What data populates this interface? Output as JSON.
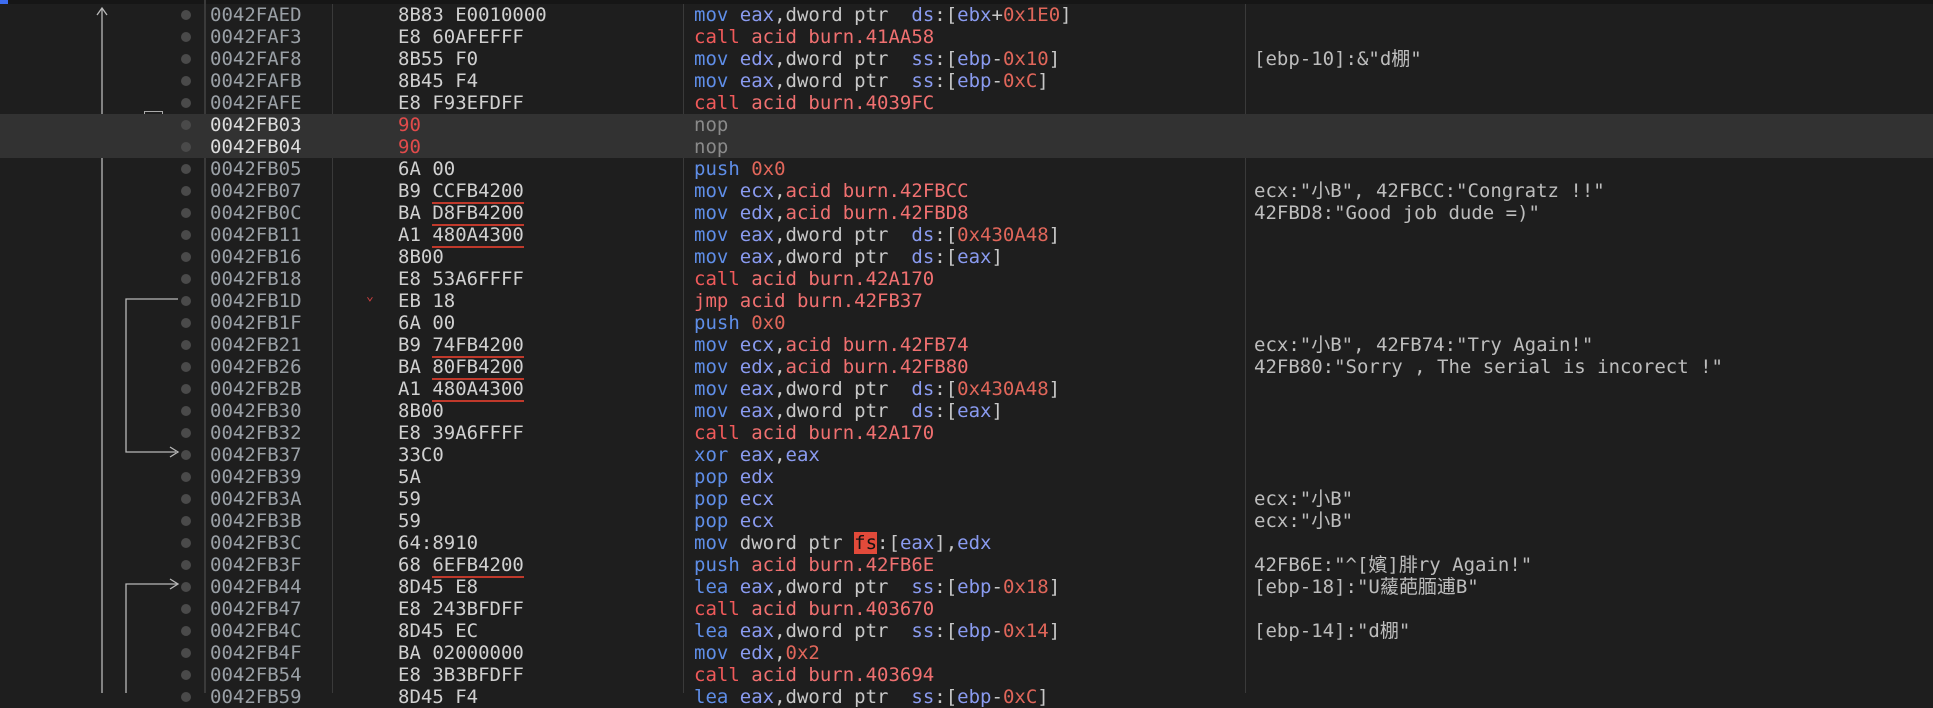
{
  "rows": [
    {
      "addr": "0042FAED",
      "bytes": [
        {
          "t": "8B83 E0010000"
        }
      ],
      "dis": [
        {
          "t": "mov ",
          "c": "m"
        },
        {
          "t": "eax",
          "c": "r"
        },
        {
          "t": ",dword ptr  ",
          "c": "p"
        },
        {
          "t": "ds",
          "c": "r"
        },
        {
          "t": ":[",
          "c": "p"
        },
        {
          "t": "ebx",
          "c": "r"
        },
        {
          "t": "+",
          "c": "p"
        },
        {
          "t": "0x1E0",
          "c": "n"
        },
        {
          "t": "]",
          "c": "p"
        }
      ],
      "comment": ""
    },
    {
      "addr": "0042FAF3",
      "bytes": [
        {
          "t": "E8 60AFEFFF"
        }
      ],
      "dis": [
        {
          "t": "call ",
          "c": "mc"
        },
        {
          "t": "acid burn.41AA58",
          "c": "sym"
        }
      ],
      "comment": ""
    },
    {
      "addr": "0042FAF8",
      "bytes": [
        {
          "t": "8B55 F0"
        }
      ],
      "dis": [
        {
          "t": "mov ",
          "c": "m"
        },
        {
          "t": "edx",
          "c": "r"
        },
        {
          "t": ",dword ptr  ",
          "c": "p"
        },
        {
          "t": "ss",
          "c": "r"
        },
        {
          "t": ":[",
          "c": "p"
        },
        {
          "t": "ebp",
          "c": "r"
        },
        {
          "t": "-",
          "c": "p"
        },
        {
          "t": "0x10",
          "c": "n"
        },
        {
          "t": "]",
          "c": "p"
        }
      ],
      "comment": "[ebp-10]:&\"d棚\""
    },
    {
      "addr": "0042FAFB",
      "bytes": [
        {
          "t": "8B45 F4"
        }
      ],
      "dis": [
        {
          "t": "mov ",
          "c": "m"
        },
        {
          "t": "eax",
          "c": "r"
        },
        {
          "t": ",dword ptr  ",
          "c": "p"
        },
        {
          "t": "ss",
          "c": "r"
        },
        {
          "t": ":[",
          "c": "p"
        },
        {
          "t": "ebp",
          "c": "r"
        },
        {
          "t": "-",
          "c": "p"
        },
        {
          "t": "0xC",
          "c": "n"
        },
        {
          "t": "]",
          "c": "p"
        }
      ],
      "comment": ""
    },
    {
      "addr": "0042FAFE",
      "bytes": [
        {
          "t": "E8 F93EFDFF"
        }
      ],
      "dis": [
        {
          "t": "call ",
          "c": "mc"
        },
        {
          "t": "acid burn.4039FC",
          "c": "sym"
        }
      ],
      "comment": ""
    },
    {
      "addr": "0042FB03",
      "bytes": [
        {
          "t": "90"
        }
      ],
      "nop": true,
      "sel": true,
      "dis": [
        {
          "t": "nop",
          "c": "mn"
        }
      ],
      "comment": ""
    },
    {
      "addr": "0042FB04",
      "bytes": [
        {
          "t": "90"
        }
      ],
      "nop": true,
      "sel": true,
      "dis": [
        {
          "t": "nop",
          "c": "mn"
        }
      ],
      "comment": ""
    },
    {
      "addr": "0042FB05",
      "bytes": [
        {
          "t": "6A 00"
        }
      ],
      "dis": [
        {
          "t": "push ",
          "c": "m"
        },
        {
          "t": "0x0",
          "c": "n"
        }
      ],
      "comment": ""
    },
    {
      "addr": "0042FB07",
      "bytes": [
        {
          "t": "B9 "
        },
        {
          "t": "CCFB4200",
          "u": true
        }
      ],
      "dis": [
        {
          "t": "mov ",
          "c": "m"
        },
        {
          "t": "ecx",
          "c": "r"
        },
        {
          "t": ",",
          "c": "p"
        },
        {
          "t": "acid burn.42FBCC",
          "c": "sym"
        }
      ],
      "comment": "ecx:\"小B\", 42FBCC:\"Congratz !!\""
    },
    {
      "addr": "0042FB0C",
      "bytes": [
        {
          "t": "BA "
        },
        {
          "t": "D8FB4200",
          "u": true
        }
      ],
      "dis": [
        {
          "t": "mov ",
          "c": "m"
        },
        {
          "t": "edx",
          "c": "r"
        },
        {
          "t": ",",
          "c": "p"
        },
        {
          "t": "acid burn.42FBD8",
          "c": "sym"
        }
      ],
      "comment": "42FBD8:\"Good job dude =)\""
    },
    {
      "addr": "0042FB11",
      "bytes": [
        {
          "t": "A1 "
        },
        {
          "t": "480A4300",
          "u": true
        }
      ],
      "dis": [
        {
          "t": "mov ",
          "c": "m"
        },
        {
          "t": "eax",
          "c": "r"
        },
        {
          "t": ",dword ptr  ",
          "c": "p"
        },
        {
          "t": "ds",
          "c": "r"
        },
        {
          "t": ":[",
          "c": "p"
        },
        {
          "t": "0x430A48",
          "c": "n"
        },
        {
          "t": "]",
          "c": "p"
        }
      ],
      "comment": ""
    },
    {
      "addr": "0042FB16",
      "bytes": [
        {
          "t": "8B00"
        }
      ],
      "dis": [
        {
          "t": "mov ",
          "c": "m"
        },
        {
          "t": "eax",
          "c": "r"
        },
        {
          "t": ",dword ptr  ",
          "c": "p"
        },
        {
          "t": "ds",
          "c": "r"
        },
        {
          "t": ":[",
          "c": "p"
        },
        {
          "t": "eax",
          "c": "r"
        },
        {
          "t": "]",
          "c": "p"
        }
      ],
      "comment": ""
    },
    {
      "addr": "0042FB18",
      "bytes": [
        {
          "t": "E8 53A6FFFF"
        }
      ],
      "dis": [
        {
          "t": "call ",
          "c": "mc"
        },
        {
          "t": "acid burn.42A170",
          "c": "sym"
        }
      ],
      "comment": ""
    },
    {
      "addr": "0042FB1D",
      "bytes": [
        {
          "t": "EB 18"
        }
      ],
      "jmpmark": true,
      "dis": [
        {
          "t": "jmp ",
          "c": "mj"
        },
        {
          "t": "acid burn.42FB37",
          "c": "sym"
        }
      ],
      "comment": ""
    },
    {
      "addr": "0042FB1F",
      "bytes": [
        {
          "t": "6A 00"
        }
      ],
      "dis": [
        {
          "t": "push ",
          "c": "m"
        },
        {
          "t": "0x0",
          "c": "n"
        }
      ],
      "comment": ""
    },
    {
      "addr": "0042FB21",
      "bytes": [
        {
          "t": "B9 "
        },
        {
          "t": "74FB4200",
          "u": true
        }
      ],
      "dis": [
        {
          "t": "mov ",
          "c": "m"
        },
        {
          "t": "ecx",
          "c": "r"
        },
        {
          "t": ",",
          "c": "p"
        },
        {
          "t": "acid burn.42FB74",
          "c": "sym"
        }
      ],
      "comment": "ecx:\"小B\", 42FB74:\"Try Again!\""
    },
    {
      "addr": "0042FB26",
      "bytes": [
        {
          "t": "BA "
        },
        {
          "t": "80FB4200",
          "u": true
        }
      ],
      "dis": [
        {
          "t": "mov ",
          "c": "m"
        },
        {
          "t": "edx",
          "c": "r"
        },
        {
          "t": ",",
          "c": "p"
        },
        {
          "t": "acid burn.42FB80",
          "c": "sym"
        }
      ],
      "comment": "42FB80:\"Sorry , The serial is incorect !\""
    },
    {
      "addr": "0042FB2B",
      "bytes": [
        {
          "t": "A1 "
        },
        {
          "t": "480A4300",
          "u": true
        }
      ],
      "dis": [
        {
          "t": "mov ",
          "c": "m"
        },
        {
          "t": "eax",
          "c": "r"
        },
        {
          "t": ",dword ptr  ",
          "c": "p"
        },
        {
          "t": "ds",
          "c": "r"
        },
        {
          "t": ":[",
          "c": "p"
        },
        {
          "t": "0x430A48",
          "c": "n"
        },
        {
          "t": "]",
          "c": "p"
        }
      ],
      "comment": ""
    },
    {
      "addr": "0042FB30",
      "bytes": [
        {
          "t": "8B00"
        }
      ],
      "dis": [
        {
          "t": "mov ",
          "c": "m"
        },
        {
          "t": "eax",
          "c": "r"
        },
        {
          "t": ",dword ptr  ",
          "c": "p"
        },
        {
          "t": "ds",
          "c": "r"
        },
        {
          "t": ":[",
          "c": "p"
        },
        {
          "t": "eax",
          "c": "r"
        },
        {
          "t": "]",
          "c": "p"
        }
      ],
      "comment": ""
    },
    {
      "addr": "0042FB32",
      "bytes": [
        {
          "t": "E8 39A6FFFF"
        }
      ],
      "dis": [
        {
          "t": "call ",
          "c": "mc"
        },
        {
          "t": "acid burn.42A170",
          "c": "sym"
        }
      ],
      "comment": ""
    },
    {
      "addr": "0042FB37",
      "bytes": [
        {
          "t": "33C0"
        }
      ],
      "dis": [
        {
          "t": "xor ",
          "c": "m"
        },
        {
          "t": "eax",
          "c": "r"
        },
        {
          "t": ",",
          "c": "p"
        },
        {
          "t": "eax",
          "c": "r"
        }
      ],
      "comment": ""
    },
    {
      "addr": "0042FB39",
      "bytes": [
        {
          "t": "5A"
        }
      ],
      "dis": [
        {
          "t": "pop ",
          "c": "m"
        },
        {
          "t": "edx",
          "c": "r"
        }
      ],
      "comment": ""
    },
    {
      "addr": "0042FB3A",
      "bytes": [
        {
          "t": "59"
        }
      ],
      "dis": [
        {
          "t": "pop ",
          "c": "m"
        },
        {
          "t": "ecx",
          "c": "r"
        }
      ],
      "comment": "ecx:\"小B\""
    },
    {
      "addr": "0042FB3B",
      "bytes": [
        {
          "t": "59"
        }
      ],
      "dis": [
        {
          "t": "pop ",
          "c": "m"
        },
        {
          "t": "ecx",
          "c": "r"
        }
      ],
      "comment": "ecx:\"小B\""
    },
    {
      "addr": "0042FB3C",
      "bytes": [
        {
          "t": "64:8910"
        }
      ],
      "dis": [
        {
          "t": "mov ",
          "c": "m"
        },
        {
          "t": "dword ptr ",
          "c": "p"
        },
        {
          "t": "fs",
          "c": "fs"
        },
        {
          "t": ":[",
          "c": "p"
        },
        {
          "t": "eax",
          "c": "r"
        },
        {
          "t": "],",
          "c": "p"
        },
        {
          "t": "edx",
          "c": "r"
        }
      ],
      "comment": ""
    },
    {
      "addr": "0042FB3F",
      "bytes": [
        {
          "t": "68 "
        },
        {
          "t": "6EFB4200",
          "u": true
        }
      ],
      "dis": [
        {
          "t": "push ",
          "c": "m"
        },
        {
          "t": "acid burn.42FB6E",
          "c": "sym"
        }
      ],
      "comment": "42FB6E:\"^[嬪]腓ry Again!\""
    },
    {
      "addr": "0042FB44",
      "bytes": [
        {
          "t": "8D45 E8"
        }
      ],
      "dis": [
        {
          "t": "lea ",
          "c": "m"
        },
        {
          "t": "eax",
          "c": "r"
        },
        {
          "t": ",dword ptr  ",
          "c": "p"
        },
        {
          "t": "ss",
          "c": "r"
        },
        {
          "t": ":[",
          "c": "p"
        },
        {
          "t": "ebp",
          "c": "r"
        },
        {
          "t": "-",
          "c": "p"
        },
        {
          "t": "0x18",
          "c": "n"
        },
        {
          "t": "]",
          "c": "p"
        }
      ],
      "comment": "[ebp-18]:\"U藧葩腼逋B\""
    },
    {
      "addr": "0042FB47",
      "bytes": [
        {
          "t": "E8 243BFDFF"
        }
      ],
      "dis": [
        {
          "t": "call ",
          "c": "mc"
        },
        {
          "t": "acid burn.403670",
          "c": "sym"
        }
      ],
      "comment": ""
    },
    {
      "addr": "0042FB4C",
      "bytes": [
        {
          "t": "8D45 EC"
        }
      ],
      "dis": [
        {
          "t": "lea ",
          "c": "m"
        },
        {
          "t": "eax",
          "c": "r"
        },
        {
          "t": ",dword ptr  ",
          "c": "p"
        },
        {
          "t": "ss",
          "c": "r"
        },
        {
          "t": ":[",
          "c": "p"
        },
        {
          "t": "ebp",
          "c": "r"
        },
        {
          "t": "-",
          "c": "p"
        },
        {
          "t": "0x14",
          "c": "n"
        },
        {
          "t": "]",
          "c": "p"
        }
      ],
      "comment": "[ebp-14]:\"d棚\""
    },
    {
      "addr": "0042FB4F",
      "bytes": [
        {
          "t": "BA 02000000"
        }
      ],
      "dis": [
        {
          "t": "mov ",
          "c": "m"
        },
        {
          "t": "edx",
          "c": "r"
        },
        {
          "t": ",",
          "c": "p"
        },
        {
          "t": "0x2",
          "c": "n"
        }
      ],
      "comment": ""
    },
    {
      "addr": "0042FB54",
      "bytes": [
        {
          "t": "E8 3B3BFDFF"
        }
      ],
      "dis": [
        {
          "t": "call ",
          "c": "mc"
        },
        {
          "t": "acid burn.403694",
          "c": "sym"
        }
      ],
      "comment": ""
    },
    {
      "addr": "0042FB59",
      "bytes": [
        {
          "t": "8D45 F4"
        }
      ],
      "dis": [
        {
          "t": "lea ",
          "c": "m"
        },
        {
          "t": "eax",
          "c": "r"
        },
        {
          "t": ",dword ptr  ",
          "c": "p"
        },
        {
          "t": "ss",
          "c": "r"
        },
        {
          "t": ":[",
          "c": "p"
        },
        {
          "t": "ebp",
          "c": "r"
        },
        {
          "t": "-",
          "c": "p"
        },
        {
          "t": "0xC",
          "c": "n"
        },
        {
          "t": "]",
          "c": "p"
        }
      ],
      "comment": ""
    }
  ],
  "icons": {
    "collapse": "collapse-minus-icon",
    "jump_marker": "chevron-down-icon"
  },
  "colors": {
    "background": "#1e1e1e",
    "selection": "#323232",
    "mnemonic": "#5f8ee8",
    "call": "#f05a5a",
    "register": "#8a9bf0",
    "immediate": "#e0665a",
    "nop_bytes": "#e14b4b"
  }
}
